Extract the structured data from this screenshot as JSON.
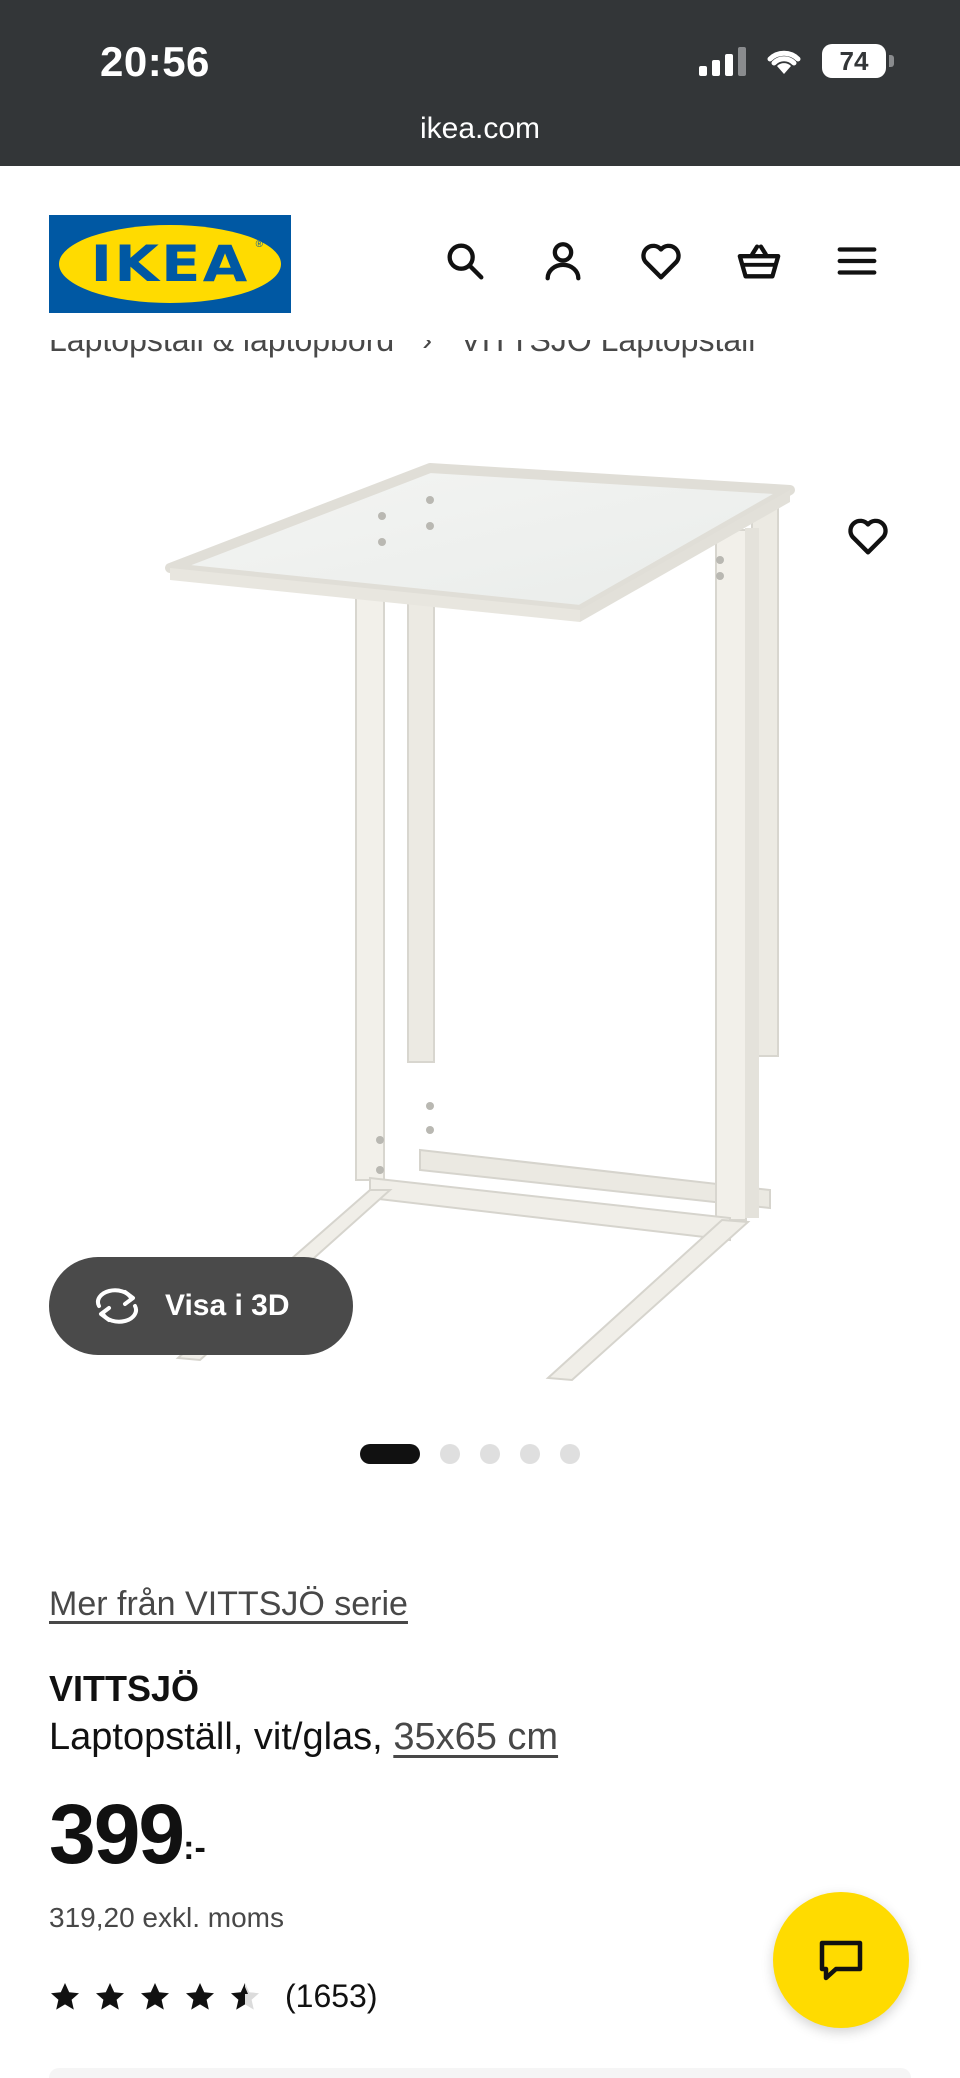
{
  "status_bar": {
    "time": "20:56",
    "battery": "74",
    "url": "ikea.com"
  },
  "header": {
    "logo_text": "IKEA",
    "icons": [
      "search-icon",
      "account-icon",
      "heart-icon",
      "basket-icon",
      "menu-icon"
    ]
  },
  "breadcrumb": {
    "items": [
      "Laptopställ & laptopbord",
      "VITTSJÖ Laptopställ"
    ]
  },
  "gallery": {
    "view_3d_label": "Visa i 3D",
    "image_count": 5,
    "active_index": 0
  },
  "product": {
    "series_link": "Mer från VITTSJÖ serie",
    "name": "VITTSJÖ",
    "description": "Laptopställ, vit/glas, ",
    "size": "35x65 cm",
    "price": "399",
    "price_suffix": ":-",
    "price_excl": "319,20 exkl. moms",
    "rating": 4.5,
    "rating_count": "(1653)"
  },
  "colors": {
    "ikea_blue": "#0058a3",
    "ikea_yellow": "#ffdb00",
    "status_bar": "#333638"
  }
}
